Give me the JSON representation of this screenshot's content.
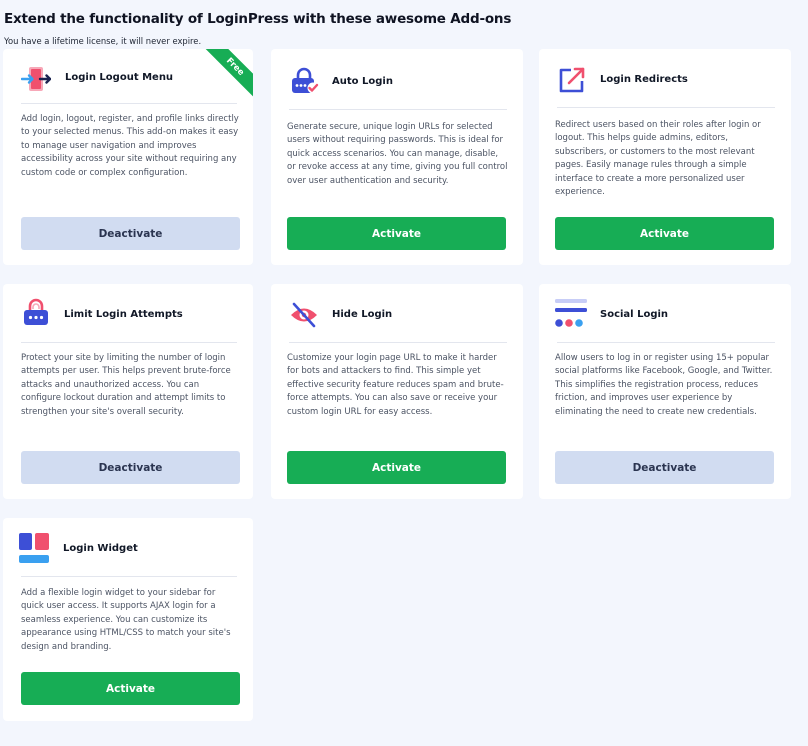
{
  "header": {
    "title": "Extend the functionality of LoginPress with these awesome Add-ons",
    "subtitle": "You have a lifetime license, it will never expire."
  },
  "addons": [
    {
      "key": "login-logout-menu",
      "title": "Login Logout Menu",
      "icon": "login-logout-menu-icon",
      "badge": "Free",
      "description": "Add login, logout, register, and profile links directly to your selected menus. This add-on makes it easy to manage user navigation and improves accessibility across your site without requiring any custom code or complex configuration.",
      "button": "Deactivate",
      "state": "active"
    },
    {
      "key": "auto-login",
      "title": "Auto Login",
      "icon": "lock-check-icon",
      "description": "Generate secure, unique login URLs for selected users without requiring passwords. This is ideal for quick access scenarios. You can manage, disable, or revoke access at any time, giving you full control over user authentication and security.",
      "button": "Activate",
      "state": "inactive"
    },
    {
      "key": "login-redirects",
      "title": "Login Redirects",
      "icon": "external-link-icon",
      "description": "Redirect users based on their roles after login or logout. This helps guide admins, editors, subscribers, or customers to the most relevant pages. Easily manage rules through a simple interface to create a more personalized user experience.",
      "button": "Activate",
      "state": "inactive"
    },
    {
      "key": "limit-login-attempts",
      "title": "Limit Login Attempts",
      "icon": "padlock-icon",
      "description": "Protect your site by limiting the number of login attempts per user. This helps prevent brute-force attacks and unauthorized access. You can configure lockout duration and attempt limits to strengthen your site's overall security.",
      "button": "Deactivate",
      "state": "active"
    },
    {
      "key": "hide-login",
      "title": "Hide Login",
      "icon": "eye-off-icon",
      "description": "Customize your login page URL to make it harder for bots and attackers to find. This simple yet effective security feature reduces spam and brute-force attempts. You can also save or receive your custom login URL for easy access.",
      "button": "Activate",
      "state": "inactive"
    },
    {
      "key": "social-login",
      "title": "Social Login",
      "icon": "social-login-icon",
      "description": "Allow users to log in or register using 15+ popular social platforms like Facebook, Google, and Twitter. This simplifies the registration process, reduces friction, and improves user experience by eliminating the need to create new credentials.",
      "button": "Deactivate",
      "state": "active"
    },
    {
      "key": "login-widget",
      "title": "Login Widget",
      "icon": "widget-icon",
      "description": "Add a flexible login widget to your sidebar for quick user access. It supports AJAX login for a seamless experience. You can customize its appearance using HTML/CSS to match your site's design and branding.",
      "button": "Activate",
      "state": "inactive"
    }
  ],
  "colors": {
    "background": "#f3f6fd",
    "activate": "#17ad55",
    "deactivate": "#d1dcf1",
    "brand_blue": "#3d4fd6",
    "brand_pink": "#f0506e"
  }
}
